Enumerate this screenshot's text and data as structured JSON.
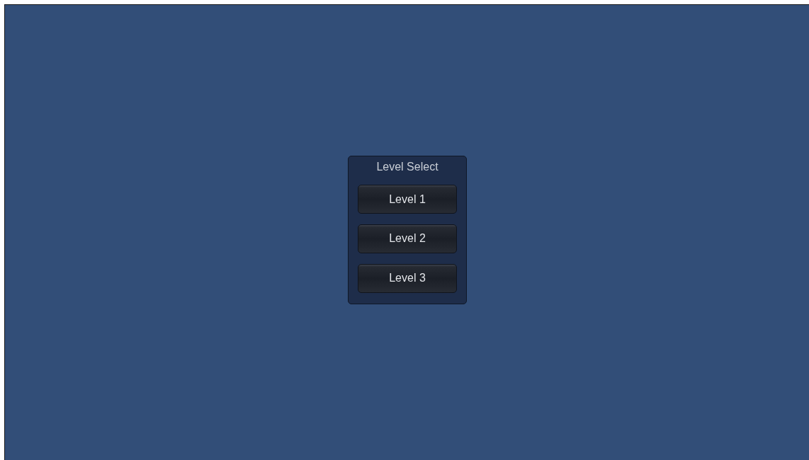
{
  "panel": {
    "title": "Level Select"
  },
  "buttons": [
    "Level 1",
    "Level 2",
    "Level 3"
  ]
}
